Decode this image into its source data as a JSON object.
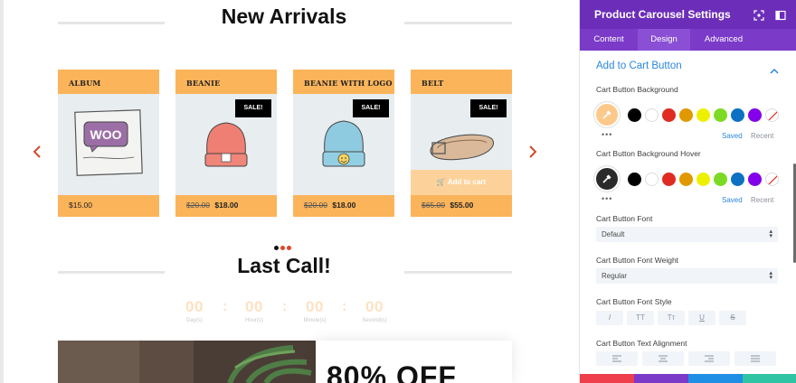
{
  "canvas": {
    "new_arrivals_title": "New Arrivals",
    "prev_arrow": "chevron-left-icon",
    "next_arrow": "chevron-right-icon",
    "products": [
      {
        "name": "ALBUM",
        "price": "$15.00",
        "old_price": "",
        "sale_badge": ""
      },
      {
        "name": "BEANIE",
        "price": "$18.00",
        "old_price": "$20.00",
        "sale_badge": "SALE!"
      },
      {
        "name": "BEANIE WITH LOGO",
        "price": "$18.00",
        "old_price": "$20.00",
        "sale_badge": "SALE!"
      },
      {
        "name": "BELT",
        "price": "$55.00",
        "old_price": "$65.00",
        "sale_badge": "SALE!",
        "add_to_cart": "Add to cart"
      }
    ],
    "pagination_colors": [
      "#111111",
      "#e0452c",
      "#e0452c"
    ],
    "last_call_title": "Last Call!",
    "countdown": [
      {
        "value": "00",
        "label": "Day(s)"
      },
      {
        "value": "00",
        "label": "Hour(s)"
      },
      {
        "value": "00",
        "label": "Minute(s)"
      },
      {
        "value": "00",
        "label": "Second(s)"
      }
    ],
    "separator": ":",
    "promo_text": "80% OFF"
  },
  "panel": {
    "title": "Product Carousel Settings",
    "tabs": [
      "Content",
      "Design",
      "Advanced"
    ],
    "active_tab": "Design",
    "group_title": "Add to Cart Button",
    "cart_bg_label": "Cart Button Background",
    "cart_bg_hover_label": "Cart Button Background Hover",
    "swatch_colors": [
      "#000000",
      "#ffffff",
      "#e02b20",
      "#e09900",
      "#edf000",
      "#7cda24",
      "#0c71c3",
      "#8300e9"
    ],
    "selected_bg_color": "#fdc98a",
    "selected_hover_color": "#2a2a2a",
    "saved_label": "Saved",
    "recent_label": "Recent",
    "more_dots": "•••",
    "font_label": "Cart Button Font",
    "font_value": "Default",
    "weight_label": "Cart Button Font Weight",
    "weight_value": "Regular",
    "style_label": "Cart Button Font Style",
    "style_buttons": [
      "I",
      "TT",
      "Tт",
      "U",
      "S"
    ],
    "align_label": "Cart Button Text Alignment",
    "accent_color": "#2b87da",
    "header_color": "#6c2eb9",
    "footer_colors": [
      "#ef3f4d",
      "#7b3ac8",
      "#1f8fe6",
      "#2ec4a4"
    ]
  }
}
